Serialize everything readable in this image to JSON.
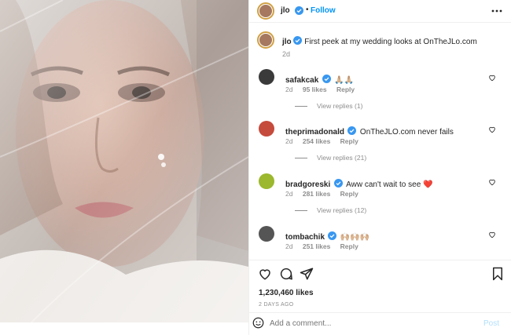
{
  "post": {
    "author": "jlo",
    "follow_label": "Follow",
    "caption": "First peek at my wedding looks at OnTheJLo.com",
    "caption_time": "2d",
    "likes": "1,230,460 likes",
    "date": "2 DAYS AGO"
  },
  "comments": [
    {
      "user": "safakcak",
      "text": "🙏🏼🙏🏼",
      "time": "2d",
      "likes": "95 likes",
      "reply": "Reply",
      "view_replies": "View replies (1)",
      "avatar_color": "#3a3a3a"
    },
    {
      "user": "theprimadonald",
      "text": "OnTheJLO.com never fails",
      "time": "2d",
      "likes": "254 likes",
      "reply": "Reply",
      "view_replies": "View replies (21)",
      "avatar_color": "#c54b3c"
    },
    {
      "user": "bradgoreski",
      "text": "Aww can't wait to see ❤️",
      "time": "2d",
      "likes": "281 likes",
      "reply": "Reply",
      "view_replies": "View replies (12)",
      "avatar_color": "#9bb82e"
    },
    {
      "user": "tombachik",
      "text": "🙌🏼🙌🏼🙌🏼",
      "time": "2d",
      "likes": "251 likes",
      "reply": "Reply",
      "view_replies": "",
      "avatar_color": "#555555"
    }
  ],
  "add_comment": {
    "placeholder": "Add a comment...",
    "post_label": "Post"
  },
  "colors": {
    "link_blue": "#0095f6",
    "verified_blue": "#3897f0",
    "heart_red": "#ed4956"
  },
  "icons": [
    "more-icon",
    "heart-icon",
    "comment-icon",
    "share-icon",
    "bookmark-icon",
    "emoji-icon",
    "verified-icon"
  ]
}
